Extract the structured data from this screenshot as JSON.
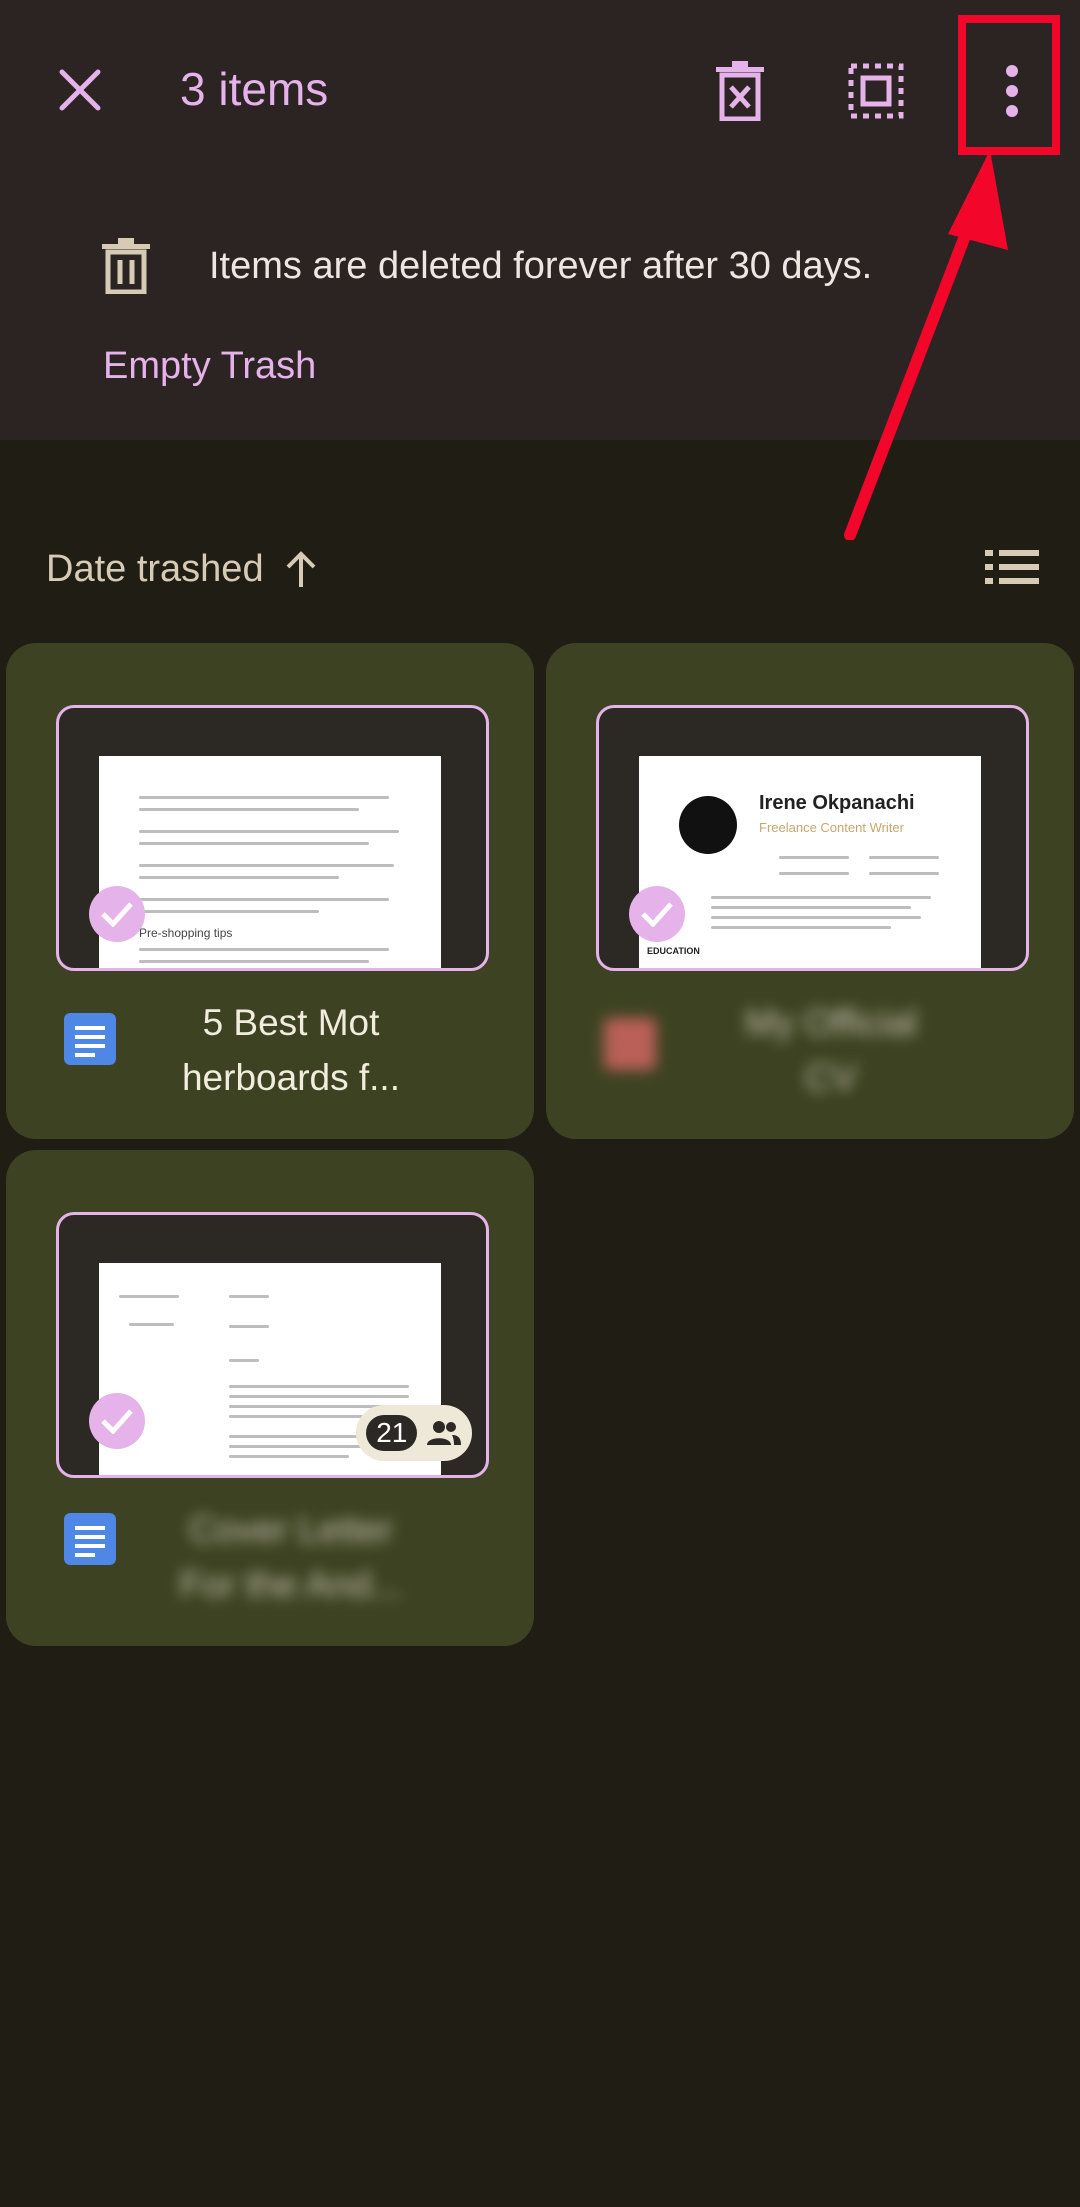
{
  "header": {
    "title": "3 items",
    "close_icon": "close-icon",
    "delete_forever_icon": "delete-forever-icon",
    "select_all_icon": "select-all-icon",
    "more_icon": "more-vert-icon"
  },
  "banner": {
    "message": "Items are deleted forever after 30 days.",
    "action_label": "Empty Trash"
  },
  "sort": {
    "label": "Date trashed",
    "direction_icon": "arrow-up-icon",
    "view_toggle_icon": "list-view-icon"
  },
  "files": [
    {
      "name": "5 Best Motherboards f...",
      "name_line1": "5 Best Mot",
      "name_line2": "herboards f...",
      "type": "google-docs",
      "selected": true,
      "preview": {
        "heading": "Pre-shopping tips"
      }
    },
    {
      "name": "My Official CV",
      "name_line1": "My Official",
      "name_line2": "CV",
      "type": "pdf",
      "selected": true,
      "preview": {
        "person_name": "Irene Okpanachi",
        "role": "Freelance Content Writer",
        "section": "EDUCATION"
      }
    },
    {
      "name": "Cover Letter For the And...",
      "name_line1": "Cover Letter",
      "name_line2": "For the And...",
      "type": "google-docs",
      "selected": true,
      "shared_count": "21",
      "preview": {}
    }
  ],
  "colors": {
    "accent": "#e5b2ea",
    "card": "#3d4322",
    "header_bg": "#2b2423",
    "page_bg": "#201d15",
    "annotation": "#f2062a"
  }
}
